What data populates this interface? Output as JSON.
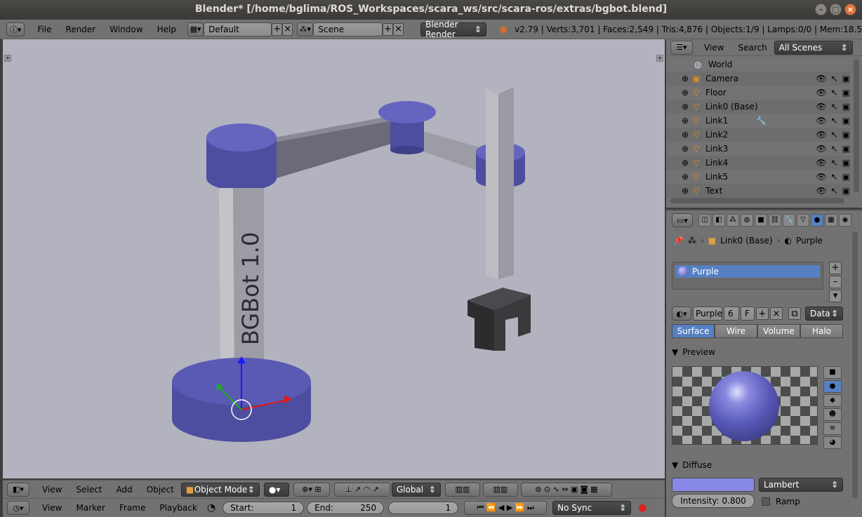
{
  "window": {
    "title": "Blender* [/home/bglima/ROS_Workspaces/scara_ws/src/scara-ros/extras/bgbot.blend]"
  },
  "info_header": {
    "menus": [
      "File",
      "Render",
      "Window",
      "Help"
    ],
    "layout": "Default",
    "scene": "Scene",
    "render_engine": "Blender Render",
    "stats": "v2.79 | Verts:3,701 | Faces:2,549 | Tris:4,876 | Objects:1/9 | Lamps:0/0 | Mem:18.5"
  },
  "viewport": {
    "text_object": "BGBot 1.0",
    "colors": {
      "background": "#b3b3bf",
      "purple": "#5858b0",
      "grey": "#a8a8a8"
    }
  },
  "view3d_header": {
    "menus": [
      "View",
      "Select",
      "Add",
      "Object"
    ],
    "mode": "Object Mode",
    "orientation": "Global"
  },
  "timeline": {
    "menus": [
      "View",
      "Marker",
      "Frame",
      "Playback"
    ],
    "start_label": "Start:",
    "start_value": "1",
    "end_label": "End:",
    "end_value": "250",
    "current_frame": "1",
    "sync": "No Sync"
  },
  "outliner": {
    "menus": [
      "View",
      "Search"
    ],
    "filter": "All Scenes",
    "items": [
      {
        "label": "World"
      },
      {
        "label": "Camera"
      },
      {
        "label": "Floor"
      },
      {
        "label": "Link0 (Base)"
      },
      {
        "label": "Link1"
      },
      {
        "label": "Link2"
      },
      {
        "label": "Link3"
      },
      {
        "label": "Link4"
      },
      {
        "label": "Link5"
      },
      {
        "label": "Text"
      }
    ]
  },
  "properties": {
    "breadcrumb_object": "Link0 (Base)",
    "breadcrumb_material": "Purple",
    "material_slot": "Purple",
    "material_name": "Purple",
    "users": "6",
    "fake": "F",
    "link": "Data",
    "tabs": [
      "Surface",
      "Wire",
      "Volume",
      "Halo"
    ],
    "preview_label": "Preview",
    "diffuse_label": "Diffuse",
    "diffuse_shader": "Lambert",
    "intensity_label": "Intensity:",
    "intensity_value": "0.800",
    "ramp_label": "Ramp"
  }
}
